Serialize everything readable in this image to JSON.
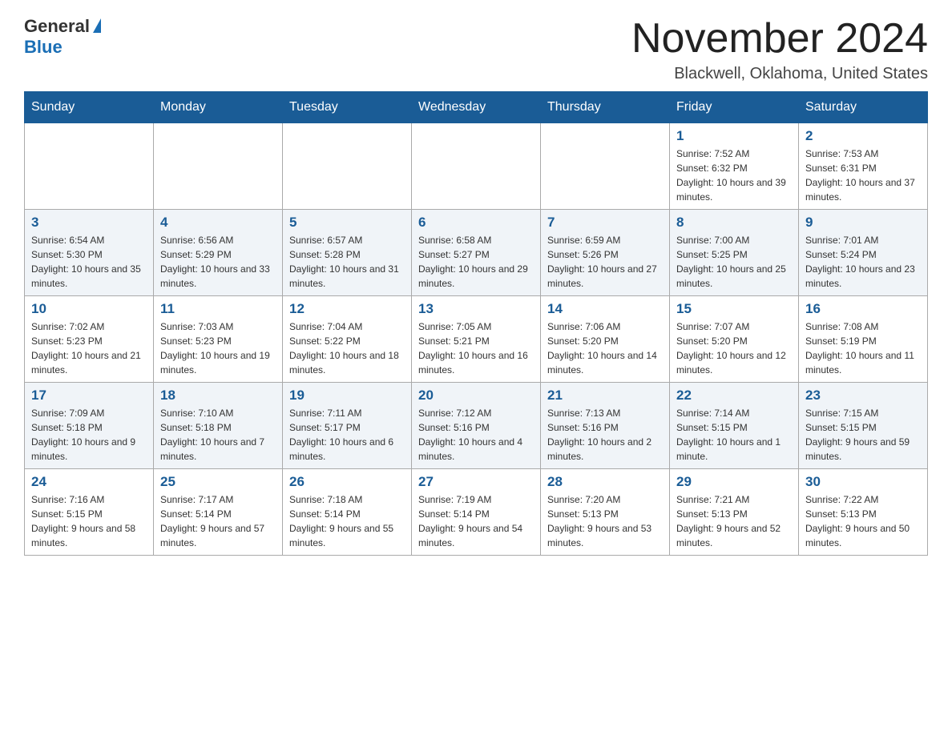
{
  "logo": {
    "general": "General",
    "blue": "Blue"
  },
  "title": "November 2024",
  "location": "Blackwell, Oklahoma, United States",
  "days_of_week": [
    "Sunday",
    "Monday",
    "Tuesday",
    "Wednesday",
    "Thursday",
    "Friday",
    "Saturday"
  ],
  "weeks": [
    [
      {
        "day": "",
        "info": ""
      },
      {
        "day": "",
        "info": ""
      },
      {
        "day": "",
        "info": ""
      },
      {
        "day": "",
        "info": ""
      },
      {
        "day": "",
        "info": ""
      },
      {
        "day": "1",
        "info": "Sunrise: 7:52 AM\nSunset: 6:32 PM\nDaylight: 10 hours and 39 minutes."
      },
      {
        "day": "2",
        "info": "Sunrise: 7:53 AM\nSunset: 6:31 PM\nDaylight: 10 hours and 37 minutes."
      }
    ],
    [
      {
        "day": "3",
        "info": "Sunrise: 6:54 AM\nSunset: 5:30 PM\nDaylight: 10 hours and 35 minutes."
      },
      {
        "day": "4",
        "info": "Sunrise: 6:56 AM\nSunset: 5:29 PM\nDaylight: 10 hours and 33 minutes."
      },
      {
        "day": "5",
        "info": "Sunrise: 6:57 AM\nSunset: 5:28 PM\nDaylight: 10 hours and 31 minutes."
      },
      {
        "day": "6",
        "info": "Sunrise: 6:58 AM\nSunset: 5:27 PM\nDaylight: 10 hours and 29 minutes."
      },
      {
        "day": "7",
        "info": "Sunrise: 6:59 AM\nSunset: 5:26 PM\nDaylight: 10 hours and 27 minutes."
      },
      {
        "day": "8",
        "info": "Sunrise: 7:00 AM\nSunset: 5:25 PM\nDaylight: 10 hours and 25 minutes."
      },
      {
        "day": "9",
        "info": "Sunrise: 7:01 AM\nSunset: 5:24 PM\nDaylight: 10 hours and 23 minutes."
      }
    ],
    [
      {
        "day": "10",
        "info": "Sunrise: 7:02 AM\nSunset: 5:23 PM\nDaylight: 10 hours and 21 minutes."
      },
      {
        "day": "11",
        "info": "Sunrise: 7:03 AM\nSunset: 5:23 PM\nDaylight: 10 hours and 19 minutes."
      },
      {
        "day": "12",
        "info": "Sunrise: 7:04 AM\nSunset: 5:22 PM\nDaylight: 10 hours and 18 minutes."
      },
      {
        "day": "13",
        "info": "Sunrise: 7:05 AM\nSunset: 5:21 PM\nDaylight: 10 hours and 16 minutes."
      },
      {
        "day": "14",
        "info": "Sunrise: 7:06 AM\nSunset: 5:20 PM\nDaylight: 10 hours and 14 minutes."
      },
      {
        "day": "15",
        "info": "Sunrise: 7:07 AM\nSunset: 5:20 PM\nDaylight: 10 hours and 12 minutes."
      },
      {
        "day": "16",
        "info": "Sunrise: 7:08 AM\nSunset: 5:19 PM\nDaylight: 10 hours and 11 minutes."
      }
    ],
    [
      {
        "day": "17",
        "info": "Sunrise: 7:09 AM\nSunset: 5:18 PM\nDaylight: 10 hours and 9 minutes."
      },
      {
        "day": "18",
        "info": "Sunrise: 7:10 AM\nSunset: 5:18 PM\nDaylight: 10 hours and 7 minutes."
      },
      {
        "day": "19",
        "info": "Sunrise: 7:11 AM\nSunset: 5:17 PM\nDaylight: 10 hours and 6 minutes."
      },
      {
        "day": "20",
        "info": "Sunrise: 7:12 AM\nSunset: 5:16 PM\nDaylight: 10 hours and 4 minutes."
      },
      {
        "day": "21",
        "info": "Sunrise: 7:13 AM\nSunset: 5:16 PM\nDaylight: 10 hours and 2 minutes."
      },
      {
        "day": "22",
        "info": "Sunrise: 7:14 AM\nSunset: 5:15 PM\nDaylight: 10 hours and 1 minute."
      },
      {
        "day": "23",
        "info": "Sunrise: 7:15 AM\nSunset: 5:15 PM\nDaylight: 9 hours and 59 minutes."
      }
    ],
    [
      {
        "day": "24",
        "info": "Sunrise: 7:16 AM\nSunset: 5:15 PM\nDaylight: 9 hours and 58 minutes."
      },
      {
        "day": "25",
        "info": "Sunrise: 7:17 AM\nSunset: 5:14 PM\nDaylight: 9 hours and 57 minutes."
      },
      {
        "day": "26",
        "info": "Sunrise: 7:18 AM\nSunset: 5:14 PM\nDaylight: 9 hours and 55 minutes."
      },
      {
        "day": "27",
        "info": "Sunrise: 7:19 AM\nSunset: 5:14 PM\nDaylight: 9 hours and 54 minutes."
      },
      {
        "day": "28",
        "info": "Sunrise: 7:20 AM\nSunset: 5:13 PM\nDaylight: 9 hours and 53 minutes."
      },
      {
        "day": "29",
        "info": "Sunrise: 7:21 AM\nSunset: 5:13 PM\nDaylight: 9 hours and 52 minutes."
      },
      {
        "day": "30",
        "info": "Sunrise: 7:22 AM\nSunset: 5:13 PM\nDaylight: 9 hours and 50 minutes."
      }
    ]
  ]
}
